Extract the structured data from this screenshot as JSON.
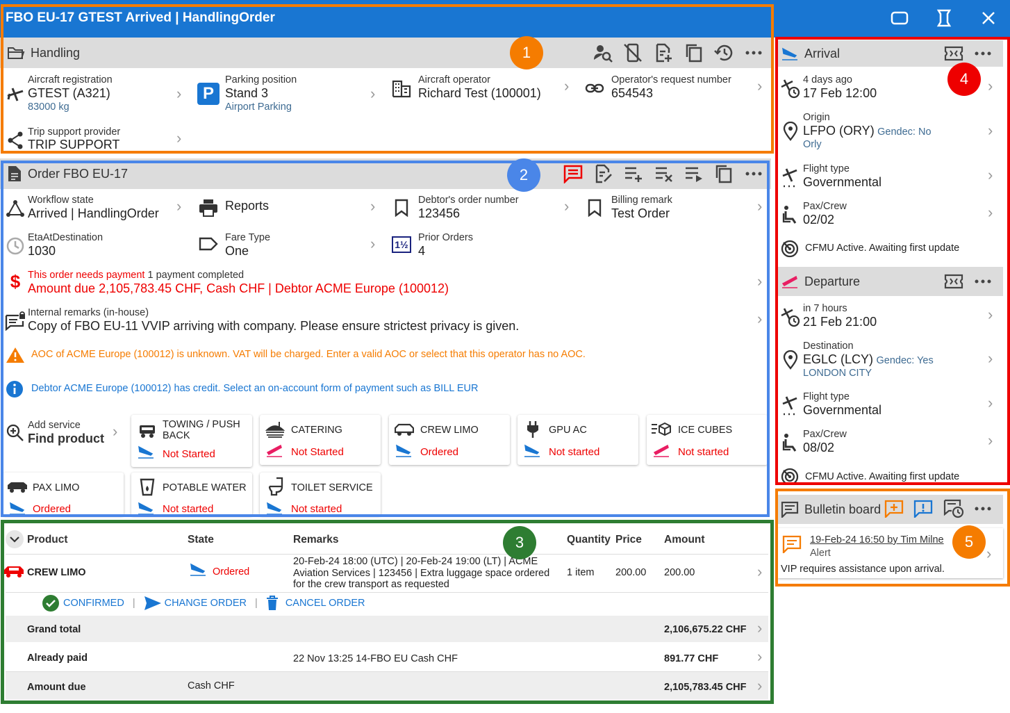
{
  "window": {
    "title": "FBO EU-17 GTEST Arrived | HandlingOrder"
  },
  "handling": {
    "title": "Handling",
    "aircraft_reg_label": "Aircraft registration",
    "aircraft_reg_value": "GTEST (A321)",
    "aircraft_reg_sub": "83000 kg",
    "parking_label": "Parking position",
    "parking_value": "Stand 3",
    "parking_sub": "Airport Parking",
    "operator_label": "Aircraft operator",
    "operator_value": "Richard Test (100001)",
    "request_label": "Operator's request number",
    "request_value": "654543",
    "trip_label": "Trip support provider",
    "trip_value": "TRIP SUPPORT"
  },
  "order": {
    "title": "Order FBO EU-17",
    "workflow_label": "Workflow state",
    "workflow_value": "Arrived | HandlingOrder",
    "reports_label": "Reports",
    "debtor_order_label": "Debtor's order number",
    "debtor_order_value": "123456",
    "billing_label": "Billing remark",
    "billing_value": "Test Order",
    "eta_label": "EtaAtDestination",
    "eta_value": "1030",
    "fare_label": "Fare Type",
    "fare_value": "One",
    "prior_label": "Prior Orders",
    "prior_value": "4",
    "prior_icon_text": "1½",
    "payment_needs": "This order needs payment",
    "payment_completed": " 1 payment completed",
    "payment_amount": "Amount due 2,105,783.45 CHF, Cash CHF | Debtor ACME Europe (100012)",
    "internal_label": "Internal remarks (in-house)",
    "internal_value": "Copy of FBO EU-11 VVIP arriving with company. Please ensure strictest privacy is given.",
    "warning": "AOC of ACME Europe (100012) is unknown. VAT will be charged. Enter a valid AOC or select that this operator has no AOC.",
    "info": "Debtor ACME Europe (100012) has credit. Select an on-account form of payment such as BILL EUR",
    "add_service_label": "Add service",
    "add_service_value": "Find product"
  },
  "services": [
    {
      "name": "TOWING / PUSH",
      "name2": "BACK",
      "status": "Not Started"
    },
    {
      "name": "CATERING",
      "status": "Not Started"
    },
    {
      "name": "CREW LIMO",
      "status": "Ordered"
    },
    {
      "name": "GPU AC",
      "status": "Not started"
    },
    {
      "name": "ICE CUBES",
      "status": "Not started"
    },
    {
      "name": "PAX LIMO",
      "status": "Ordered"
    },
    {
      "name": "POTABLE WATER",
      "status": "Not started"
    },
    {
      "name": "TOILET SERVICE",
      "status": "Not started"
    }
  ],
  "table": {
    "headers": {
      "product": "Product",
      "state": "State",
      "remarks": "Remarks",
      "quantity": "Quantity",
      "price": "Price",
      "amount": "Amount"
    },
    "row": {
      "product": "CREW LIMO",
      "state": "Ordered",
      "remarks1": "20-Feb-24 18:00 (UTC) | 20-Feb-24 19:00 (LT) | ACME",
      "remarks2": "Aviation Services | 123456 | Extra luggage space ordered",
      "remarks3": "for the crew transport as requested",
      "quantity": "1 item",
      "price": "200.00",
      "amount": "200.00"
    },
    "actions": {
      "confirmed": "CONFIRMED",
      "change": "CHANGE ORDER",
      "cancel": "CANCEL ORDER",
      "sep": "|"
    },
    "grand_total_label": "Grand total",
    "grand_total_value": "2,106,675.22 CHF",
    "paid_label": "Already paid",
    "paid_remarks": "22 Nov 13:25 14-FBO EU Cash CHF",
    "paid_value": "891.77 CHF",
    "due_label": "Amount due",
    "due_state": "Cash CHF",
    "due_value": "2,105,783.45 CHF"
  },
  "arrival": {
    "title": "Arrival",
    "time_rel": "4 days ago",
    "time_abs": "17 Feb 12:00",
    "origin_label": "Origin",
    "origin_value": "LFPO (ORY)",
    "origin_gendec": "Gendec: No",
    "origin_sub": "Orly",
    "ftype_label": "Flight type",
    "ftype_value": "Governmental",
    "pax_label": "Pax/Crew",
    "pax_value": "02/02",
    "cfmu": "CFMU Active. Awaiting first update"
  },
  "departure": {
    "title": "Departure",
    "time_rel": "in 7 hours",
    "time_abs": "21 Feb 21:00",
    "dest_label": "Destination",
    "dest_value": "EGLC (LCY)",
    "dest_gendec": "Gendec: Yes",
    "dest_sub": "LONDON CITY",
    "ftype_label": "Flight type",
    "ftype_value": "Governmental",
    "pax_label": "Pax/Crew",
    "pax_value": "08/02",
    "cfmu": "CFMU Active. Awaiting first update"
  },
  "bulletin": {
    "title": "Bulletin board",
    "entry_meta": "19-Feb-24 16:50 by Tim Milne",
    "entry_type": "Alert",
    "entry_text": "VIP requires assistance upon arrival."
  },
  "annotations": {
    "a1": "1",
    "a2": "2",
    "a3": "3",
    "a4": "4",
    "a5": "5"
  },
  "colors": {
    "blue": "#1976d2",
    "orange": "#f57c00",
    "red": "#e00000",
    "green": "#2e7d32",
    "pink": "#e91e63"
  }
}
